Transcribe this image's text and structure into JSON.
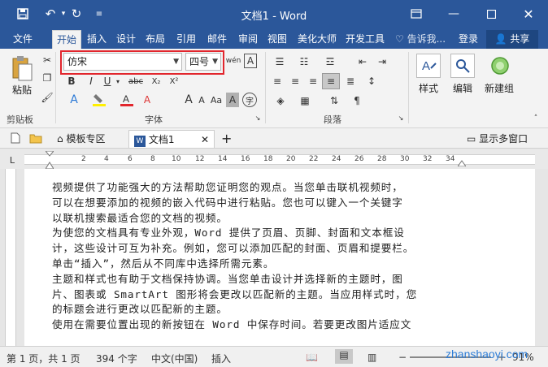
{
  "titlebar": {
    "title": "文档1 - Word",
    "save_icon": "save-icon",
    "undo_icon": "undo-icon",
    "redo_icon": "redo-icon",
    "customize_icon": "customize-icon"
  },
  "tabs": [
    {
      "label": "文件"
    },
    {
      "label": "开始"
    },
    {
      "label": "插入"
    },
    {
      "label": "设计"
    },
    {
      "label": "布局"
    },
    {
      "label": "引用"
    },
    {
      "label": "邮件"
    },
    {
      "label": "审阅"
    },
    {
      "label": "视图"
    },
    {
      "label": "美化大师"
    },
    {
      "label": "开发工具"
    }
  ],
  "tellme": "告诉我...",
  "login": "登录",
  "share": "共享",
  "ribbon": {
    "paste": "粘贴",
    "clipboard_group": "剪贴板",
    "font_name": "仿宋",
    "font_size": "四号",
    "font_group": "字体",
    "paragraph_group": "段落",
    "style_btn": "样式",
    "edit_btn": "编辑",
    "newgroup_btn": "新建组",
    "bold": "B",
    "italic": "I",
    "underline": "U",
    "strike": "abc",
    "sub": "X₂",
    "sup": "X²",
    "wen": "wén",
    "font_a": "A",
    "grow": "A",
    "shrink": "A",
    "aa": "Aa",
    "char_shade": "A",
    "enclose": "字",
    "clear": "A"
  },
  "doctabs": {
    "template": "模板专区",
    "doc": "文档1",
    "add": "+",
    "multi": "显示多窗口"
  },
  "ruler_numbers": [
    "2",
    "4",
    "6",
    "8",
    "10",
    "12",
    "14",
    "16",
    "18",
    "20",
    "22",
    "24",
    "26",
    "28",
    "30",
    "32",
    "34"
  ],
  "document": {
    "lines": [
      "视频提供了功能强大的方法帮助您证明您的观点。当您单击联机视频时，",
      "可以在想要添加的视频的嵌入代码中进行粘贴。您也可以键入一个关键字",
      "以联机搜索最适合您的文档的视频。",
      "为使您的文档具有专业外观，Word 提供了页眉、页脚、封面和文本框设",
      "计，这些设计可互为补充。例如，您可以添加匹配的封面、页眉和提要栏。",
      "单击“插入”，然后从不同库中选择所需元素。",
      "主题和样式也有助于文档保持协调。当您单击设计并选择新的主题时，图",
      "片、图表或 SmartArt 图形将会更改以匹配新的主题。当应用样式时，您",
      "的标题会进行更改以匹配新的主题。",
      "使用在需要位置出现的新按钮在 Word 中保存时间。若要更改图片适应文"
    ]
  },
  "status": {
    "page": "第 1 页，共 1 页",
    "words": "394 个字",
    "lang": "中文(中国)",
    "insert": "插入",
    "zoom": "91%"
  },
  "watermark": "zhanshaoyi.com"
}
